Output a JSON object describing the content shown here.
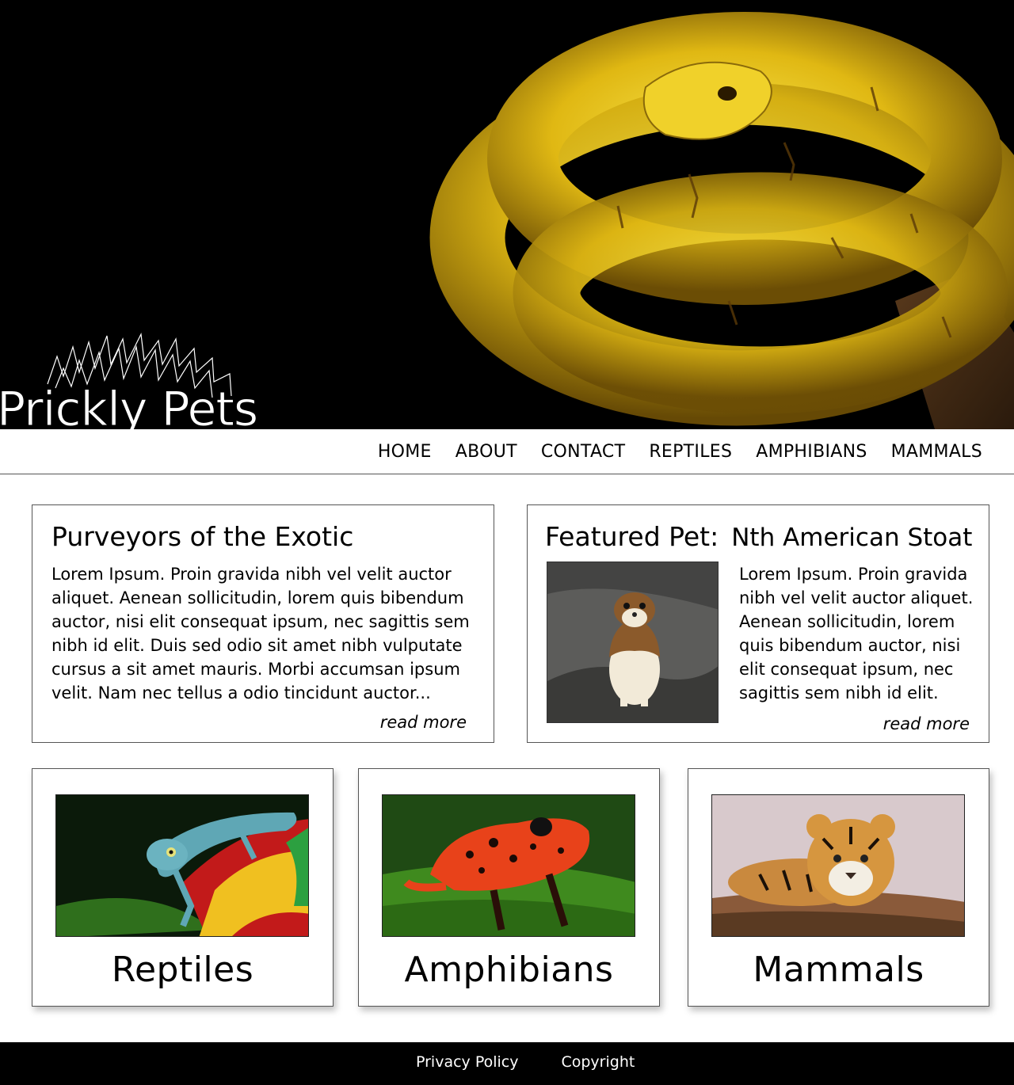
{
  "brand": {
    "name": "Prickly Pets"
  },
  "nav": {
    "items": [
      "HOME",
      "ABOUT",
      "CONTACT",
      "REPTILES",
      "AMPHIBIANS",
      "MAMMALS"
    ]
  },
  "intro": {
    "title": "Purveyors of the Exotic",
    "body": "Lorem Ipsum. Proin gravida nibh vel velit auctor aliquet. Aenean sollicitudin, lorem quis bibendum auctor, nisi elit consequat ipsum, nec sagittis sem nibh id elit. Duis sed odio sit amet nibh vulputate cursus a sit amet mauris. Morbi accumsan ipsum velit. Nam nec tellus a odio tincidunt auctor...",
    "read_more": "read more"
  },
  "featured": {
    "label": "Featured Pet:",
    "name": "Nth American Stoat",
    "body": "Lorem Ipsum. Proin gravida nibh vel velit auctor aliquet. Aenean sollicitudin, lorem quis bibendum auctor, nisi elit consequat ipsum, nec sagittis sem nibh id elit.",
    "read_more": "read more"
  },
  "categories": [
    {
      "title": "Reptiles"
    },
    {
      "title": "Amphibians"
    },
    {
      "title": "Mammals"
    }
  ],
  "footer": {
    "links": [
      "Privacy Policy",
      "Copyright"
    ]
  },
  "colors": {
    "hero_bg": "#000000",
    "snake_yellow": "#e8c21a",
    "footer_bg": "#000000",
    "border": "#555555"
  }
}
